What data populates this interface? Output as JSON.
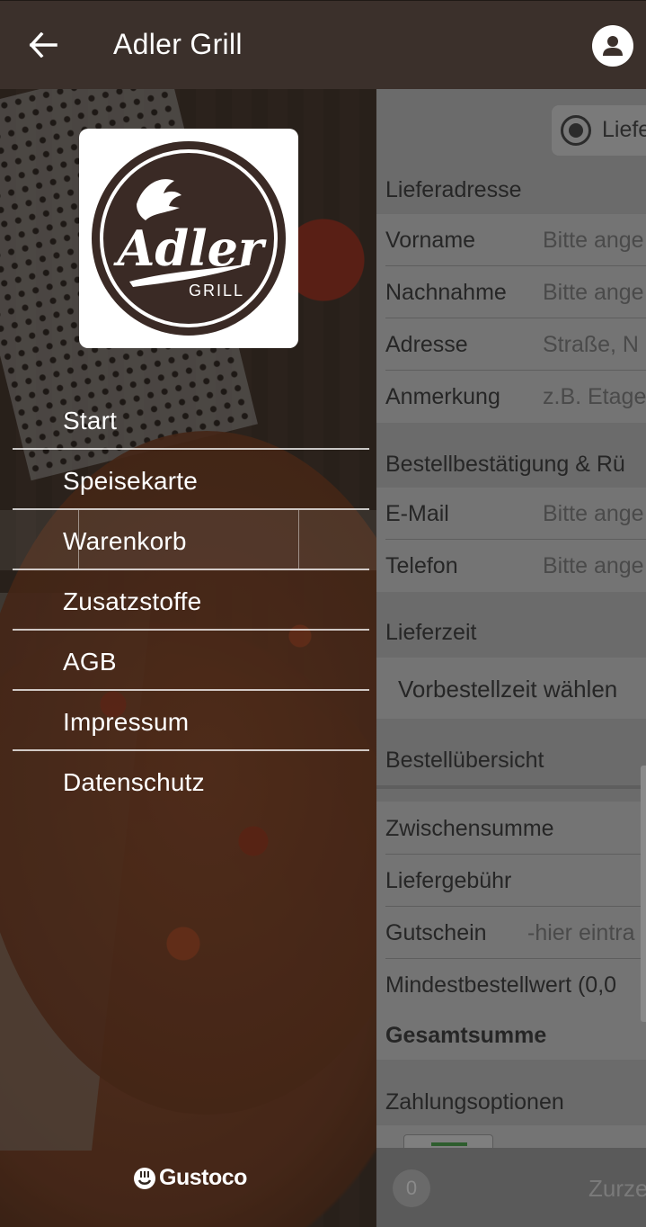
{
  "appbar": {
    "title": "Adler Grill",
    "icons": {
      "back": "arrow-left-icon",
      "profile": "user-circle-icon"
    }
  },
  "drawer": {
    "logo": {
      "wordmark": "Adler",
      "subword": "GRILL"
    },
    "menu_items": [
      {
        "label": "Start"
      },
      {
        "label": "Speisekarte"
      },
      {
        "label": "Warenkorb",
        "active": true
      },
      {
        "label": "Zusatzstoffe"
      },
      {
        "label": "AGB"
      },
      {
        "label": "Impressum"
      },
      {
        "label": "Datenschutz"
      }
    ],
    "brand": {
      "label": "Gustoco",
      "icon": "gustoco-logo-icon"
    }
  },
  "main": {
    "delivery_option": {
      "label": "Liefe",
      "selected": true
    },
    "address_section": {
      "heading": "Lieferadresse",
      "fields": [
        {
          "label": "Vorname",
          "placeholder": "Bitte ange"
        },
        {
          "label": "Nachnahme",
          "placeholder": "Bitte ange"
        },
        {
          "label": "Adresse",
          "placeholder": "Straße, N"
        },
        {
          "label": "Anmerkung",
          "placeholder": "z.B. Etage"
        }
      ]
    },
    "confirmation_section": {
      "heading": "Bestellbestätigung & Rü",
      "fields": [
        {
          "label": "E-Mail",
          "placeholder": "Bitte ange"
        },
        {
          "label": "Telefon",
          "placeholder": "Bitte ange"
        }
      ]
    },
    "delivery_time": {
      "heading": "Lieferzeit",
      "preorder_label": "Vorbestellzeit wählen"
    },
    "overview": {
      "heading": "Bestellübersicht",
      "subtotal_label": "Zwischensumme",
      "delivery_fee_label": "Liefergebühr",
      "voucher_label": "Gutschein",
      "voucher_placeholder": "-hier eintra",
      "min_order_label": "Mindestbestellwert (0,0",
      "total_label": "Gesamtsumme"
    },
    "payment": {
      "heading": "Zahlungsoptionen"
    },
    "bottom_bar": {
      "cart_count": "0",
      "back_label": "Zurze"
    }
  },
  "colors": {
    "appbar": "#3b302b",
    "overlay": "#6b6b6b",
    "text_on_dark": "#ffffff"
  }
}
